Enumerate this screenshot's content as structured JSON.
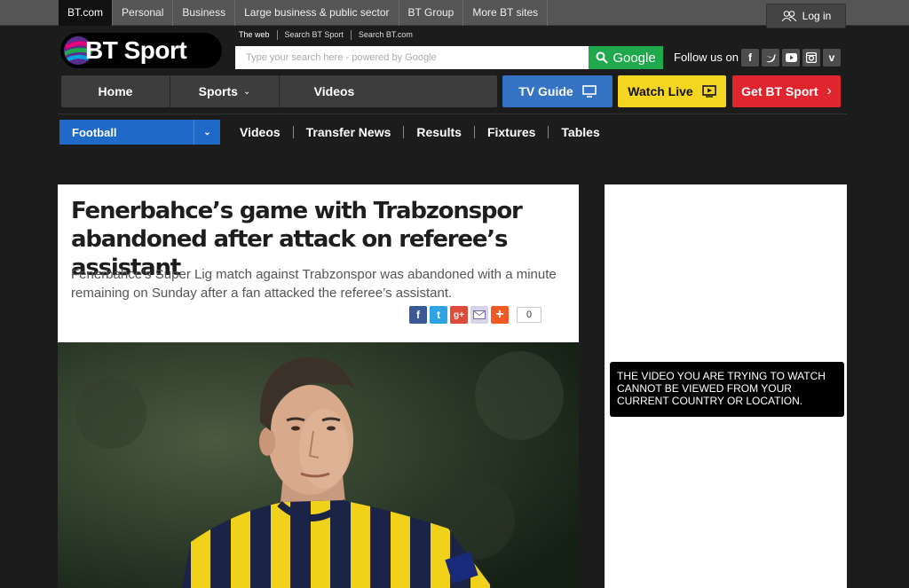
{
  "topbar": {
    "links": [
      "BT.com",
      "Personal",
      "Business",
      "Large business & public sector",
      "BT Group",
      "More BT sites"
    ],
    "login_label": "Log in"
  },
  "logo": {
    "text": "BT Sport"
  },
  "search": {
    "tabs": [
      "The web",
      "Search BT Sport",
      "Search BT.com"
    ],
    "placeholder": "Type your search here - powered by Google",
    "button_label": "Google"
  },
  "follow": {
    "label": "Follow us on",
    "icons": [
      "facebook-icon",
      "twitter-icon",
      "youtube-icon",
      "instagram-icon",
      "vine-icon"
    ]
  },
  "mainnav": {
    "items": [
      "Home",
      "Sports",
      "Videos"
    ]
  },
  "cta": {
    "tv_guide": "TV Guide",
    "watch_live": "Watch Live",
    "get_bt_sport": "Get BT Sport"
  },
  "subnav": {
    "selected_sport": "Football",
    "items": [
      "Videos",
      "Transfer News",
      "Results",
      "Fixtures",
      "Tables"
    ]
  },
  "article": {
    "headline": "Fenerbahce’s game with Trabzonspor abandoned after attack on referee’s assistant",
    "standfirst": "Fenerbahce’s Super Lig match against Trabzonspor was abandoned with a minute remaining on Sunday after a fan attacked the referee’s assistant.",
    "share_icons": [
      "facebook-icon",
      "twitter-icon",
      "google-plus-icon",
      "email-icon",
      "addthis-icon"
    ],
    "share_count": "0"
  },
  "sidebar": {
    "video_message": "THE VIDEO YOU ARE TRYING TO WATCH CANNOT BE VIEWED FROM YOUR CURRENT COUNTRY OR LOCATION."
  },
  "colors": {
    "background": "#1c1c1c",
    "search_button": "#1fa84c",
    "tv_guide": "#3573c4",
    "watch_live": "#f4d51f",
    "get_bt_sport": "#e0252e",
    "sport_select": "#1f6ac8"
  }
}
